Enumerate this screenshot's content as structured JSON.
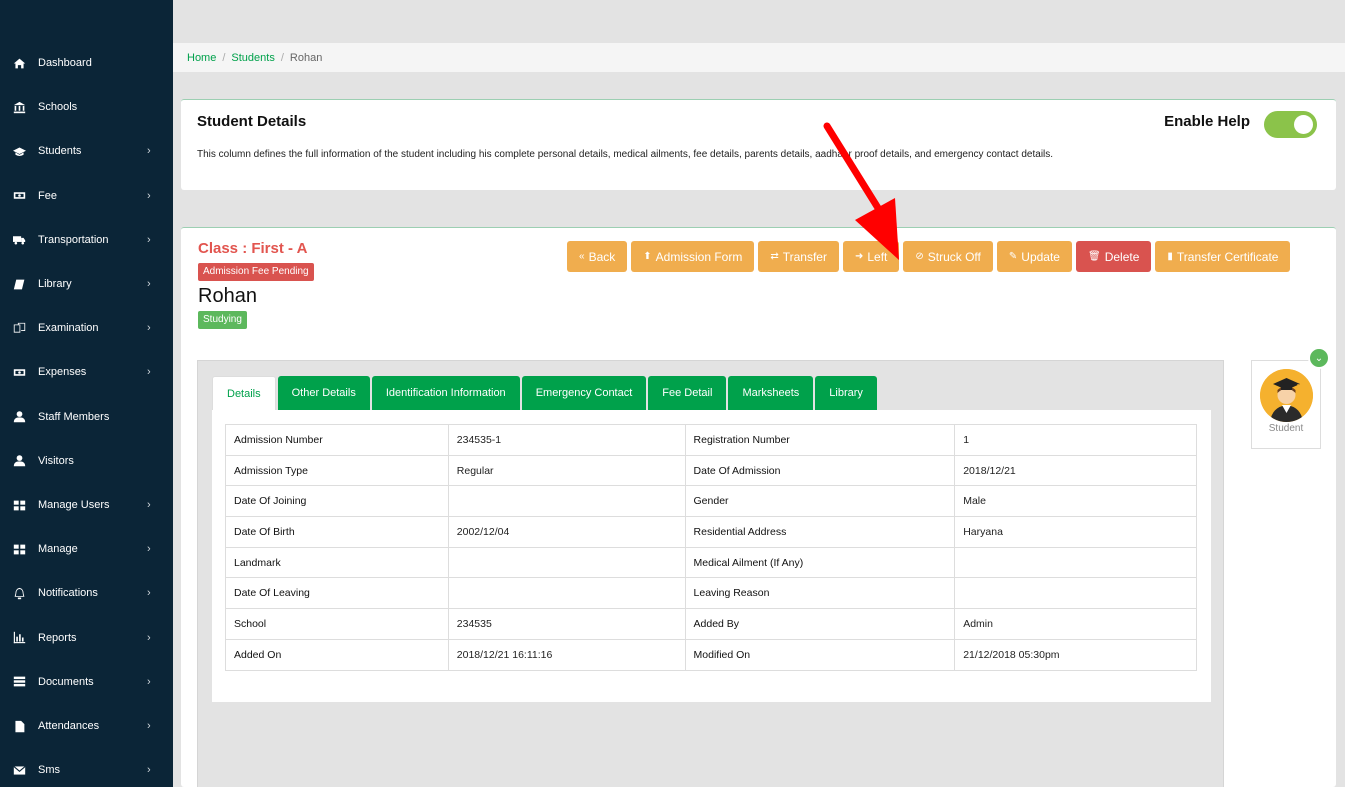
{
  "sidebar": {
    "items": [
      {
        "label": "Dashboard",
        "icon": "home-icon",
        "chevron": false
      },
      {
        "label": "Schools",
        "icon": "bank-icon",
        "chevron": false
      },
      {
        "label": "Students",
        "icon": "graduation-cap-icon",
        "chevron": true
      },
      {
        "label": "Fee",
        "icon": "money-icon",
        "chevron": true
      },
      {
        "label": "Transportation",
        "icon": "truck-icon",
        "chevron": true
      },
      {
        "label": "Library",
        "icon": "book-icon",
        "chevron": true
      },
      {
        "label": "Examination",
        "icon": "copy-icon",
        "chevron": true
      },
      {
        "label": "Expenses",
        "icon": "money-icon",
        "chevron": true
      },
      {
        "label": "Staff Members",
        "icon": "user-icon",
        "chevron": false
      },
      {
        "label": "Visitors",
        "icon": "user-icon",
        "chevron": false
      },
      {
        "label": "Manage Users",
        "icon": "grid-icon",
        "chevron": true
      },
      {
        "label": "Manage",
        "icon": "grid-icon",
        "chevron": true
      },
      {
        "label": "Notifications",
        "icon": "bell-icon",
        "chevron": true
      },
      {
        "label": "Reports",
        "icon": "bar-chart-icon",
        "chevron": true
      },
      {
        "label": "Documents",
        "icon": "list-icon",
        "chevron": true
      },
      {
        "label": "Attendances",
        "icon": "file-icon",
        "chevron": true
      },
      {
        "label": "Sms",
        "icon": "envelope-icon",
        "chevron": true
      }
    ],
    "chevron_glyph": "›"
  },
  "breadcrumb": {
    "home": "Home",
    "students": "Students",
    "current": "Rohan",
    "sep": "/"
  },
  "help": {
    "title": "Student Details",
    "description": "This column defines the full information of the student including his complete personal details, medical ailments, fee details, parents details, aadhaar proof details, and emergency contact details.",
    "toggle_label": "Enable Help",
    "toggle_on": true
  },
  "student": {
    "class_title": "Class : First - A",
    "fee_badge": "Admission Fee Pending",
    "name": "Rohan",
    "status_badge": "Studying"
  },
  "actions": [
    {
      "label": "Back",
      "icon": "«",
      "color": "#f0ad4e"
    },
    {
      "label": "Admission Form",
      "icon": "⬆",
      "color": "#f0ad4e"
    },
    {
      "label": "Transfer",
      "icon": "⇄",
      "color": "#f0ad4e"
    },
    {
      "label": "Left",
      "icon": "➜",
      "color": "#f0ad4e"
    },
    {
      "label": "Struck Off",
      "icon": "⊘",
      "color": "#f0ad4e"
    },
    {
      "label": "Update",
      "icon": "✎",
      "color": "#f0ad4e"
    },
    {
      "label": "Delete",
      "icon": "🗑",
      "color": "#d9534f"
    },
    {
      "label": "Transfer Certificate",
      "icon": "▮",
      "color": "#f0ad4e"
    }
  ],
  "tabs": [
    "Details",
    "Other Details",
    "Identification Information",
    "Emergency Contact",
    "Fee Detail",
    "Marksheets",
    "Library"
  ],
  "details": [
    [
      "Admission Number",
      "234535-1",
      "Registration Number",
      "1"
    ],
    [
      "Admission Type",
      "Regular",
      "Date Of Admission",
      "2018/12/21"
    ],
    [
      "Date Of Joining",
      "",
      "Gender",
      "Male"
    ],
    [
      "Date Of Birth",
      "2002/12/04",
      "Residential Address",
      "Haryana"
    ],
    [
      "Landmark",
      "",
      "Medical Ailment (If Any)",
      ""
    ],
    [
      "Date Of Leaving",
      "",
      "Leaving Reason",
      ""
    ],
    [
      "School",
      "234535",
      "Added By",
      "Admin"
    ],
    [
      "Added On",
      "2018/12/21 16:11:16",
      "Modified On",
      "21/12/2018 05:30pm"
    ]
  ],
  "profile": {
    "label": "Student",
    "toggle_icon": "chevron-down-icon"
  },
  "colors": {
    "sidebar": "#0b2537",
    "green": "#00a14b",
    "orange": "#f0ad4e",
    "red": "#d9534f",
    "toggle": "#8bc34a"
  }
}
